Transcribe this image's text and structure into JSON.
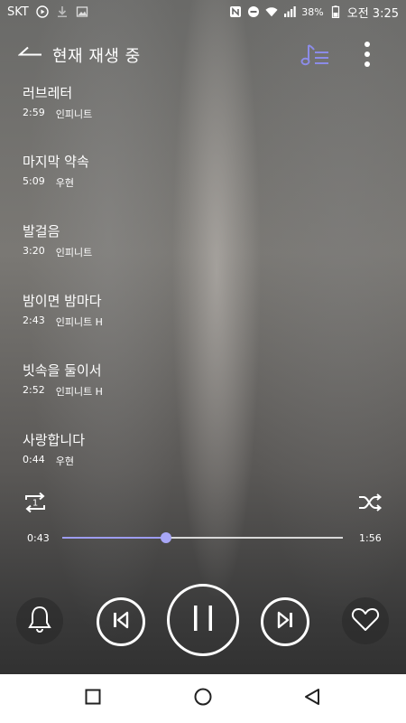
{
  "status_bar": {
    "carrier": "SKT",
    "battery": "38%",
    "time": "오전 3:25"
  },
  "header": {
    "title": "현재 재생 중"
  },
  "playlist": [
    {
      "title": "러브레터",
      "duration": "2:59",
      "artist": "인피니트"
    },
    {
      "title": "마지막 약속",
      "duration": "5:09",
      "artist": "우현"
    },
    {
      "title": "발걸음",
      "duration": "3:20",
      "artist": "인피니트"
    },
    {
      "title": "밤이면 밤마다",
      "duration": "2:43",
      "artist": "인피니트 H"
    },
    {
      "title": "빗속을 둘이서",
      "duration": "2:52",
      "artist": "인피니트 H"
    },
    {
      "title": "사랑합니다",
      "duration": "0:44",
      "artist": "우현"
    }
  ],
  "player": {
    "current_time": "0:43",
    "total_time": "1:56",
    "progress": 0.37,
    "repeat_badge": "1"
  },
  "colors": {
    "accent": "#a8a7f7",
    "progress_track": "#d8d8d8"
  },
  "icons": [
    "back-arrow-icon",
    "queue-icon",
    "more-vert-icon",
    "repeat-one-icon",
    "shuffle-icon",
    "bell-icon",
    "previous-icon",
    "pause-icon",
    "next-icon",
    "heart-icon",
    "recent-apps-icon",
    "home-icon",
    "back-triangle-icon"
  ]
}
